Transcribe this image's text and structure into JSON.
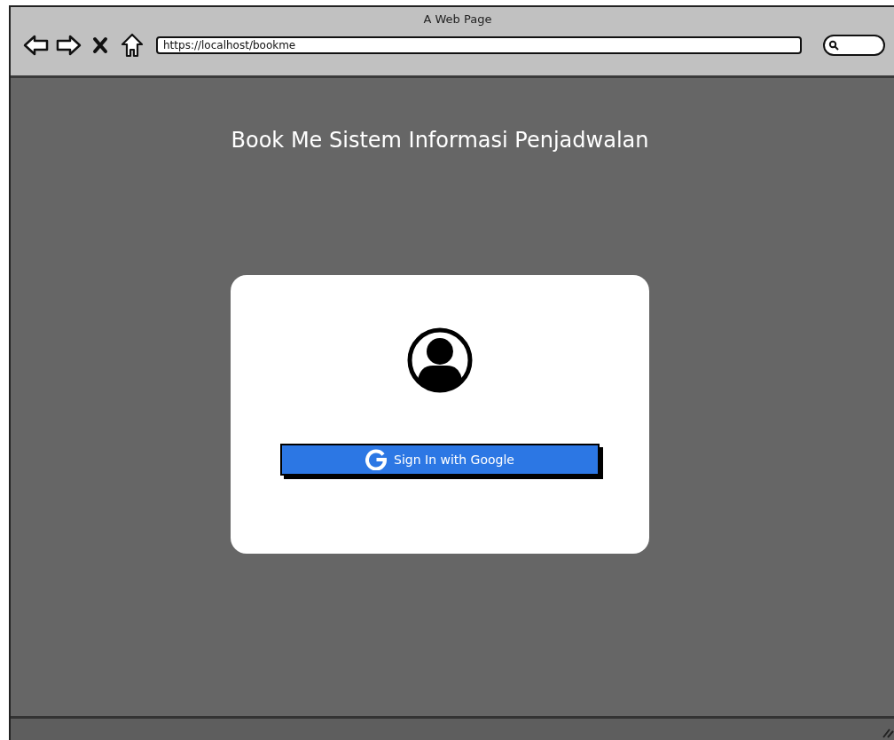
{
  "window": {
    "title": "A Web Page"
  },
  "browser": {
    "address": "https://localhost/bookme"
  },
  "page": {
    "heading": "Book Me Sistem Informasi Penjadwalan"
  },
  "login_card": {
    "button": "Sign In with Google"
  }
}
